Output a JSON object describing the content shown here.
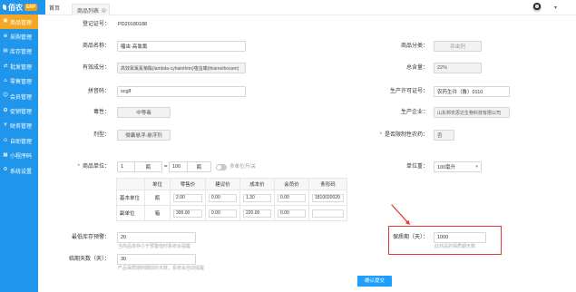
{
  "colors": {
    "sidebar": "#1f95ec",
    "sidebar_active": "#f5a623",
    "brand_badge": "#f39c12",
    "primary_button": "#1e9fff",
    "annotation": "#e53935"
  },
  "app": {
    "brand": "佰农",
    "badge": "ERP"
  },
  "sidebar": {
    "items": [
      {
        "label": "商品管理",
        "icon": "box-icon",
        "active": true
      },
      {
        "label": "采购管理",
        "icon": "cart-icon"
      },
      {
        "label": "库存管理",
        "icon": "inventory-icon"
      },
      {
        "label": "批发管理",
        "icon": "truck-icon"
      },
      {
        "label": "零售管理",
        "icon": "shop-icon"
      },
      {
        "label": "会员管理",
        "icon": "user-icon"
      },
      {
        "label": "促销管理",
        "icon": "gift-icon"
      },
      {
        "label": "财务管理",
        "icon": "yen-icon"
      },
      {
        "label": "自助管理",
        "icon": "self-service-icon"
      },
      {
        "label": "小程序码",
        "icon": "qrcode-icon"
      },
      {
        "label": "系统设置",
        "icon": "gear-icon"
      }
    ]
  },
  "header": {
    "tabs": [
      {
        "label": "首页"
      },
      {
        "label": "商品列表",
        "active": true,
        "closable": true,
        "close_icon": "close-icon"
      }
    ],
    "user_menu_icon": "chevron-down-icon"
  },
  "form": {
    "reg_no": {
      "label": "登记证号：",
      "value": "PD20180188"
    },
    "name": {
      "label": "商品名称：",
      "value": "噻虫·高氯氟"
    },
    "category": {
      "label": "商品分类：",
      "value": "杀虫剂"
    },
    "ingredient": {
      "label": "有效成分：",
      "value": "高效氯氟氰菊酯(lambda-cyhalothrin)噻虫嗪(thiamethoxam)"
    },
    "content": {
      "label": "总含量：",
      "value": "22%"
    },
    "pinyin": {
      "label": "拼音码：",
      "value": "scglf"
    },
    "license": {
      "label": "生产许可证号：",
      "value": "农药生许（鲁）0110"
    },
    "toxicity": {
      "label": "毒性：",
      "value": "中等毒"
    },
    "maker": {
      "label": "生产企业：",
      "value": "山东邦农思达生物科技有限公司"
    },
    "formulation": {
      "label": "剂型：",
      "value": "微囊悬浮-悬浮剂"
    },
    "restricted": {
      "required_mark": "*",
      "label": "是否限制性农药：",
      "value": "否"
    },
    "unit": {
      "required_mark": "*",
      "label": "商品单位：",
      "base_qty": "1",
      "base_unit": "瓶",
      "equals": "=",
      "sub_qty": "100",
      "sub_unit": "瓶",
      "multi_unit_on": false,
      "toggle_label": "多单位开/关"
    },
    "unit_weight": {
      "label": "单位重：",
      "value": "100毫升"
    },
    "price_table": {
      "headers": [
        "单位",
        "零售价",
        "建议价",
        "成本价",
        "会员价",
        "条形码"
      ],
      "rows": [
        {
          "name": "基本单位",
          "unit": "瓶",
          "retail": "2.00",
          "suggested": "0.00",
          "cost": "1.30",
          "member": "0.00",
          "barcode": "1810020020"
        },
        {
          "name": "副单位",
          "unit": "箱",
          "retail": "300.00",
          "suggested": "0.00",
          "cost": "220.00",
          "member": "0.00"
        }
      ]
    },
    "min_stock": {
      "label": "最低库存预警：",
      "value": "20",
      "hint": "当商品库存小于预警值时系统会提醒"
    },
    "shelf_life": {
      "label": "保质期（天）：",
      "value": "1000",
      "hint": "此商品的保质期天数"
    },
    "expiry_days": {
      "label": "临期天数（天）：",
      "value": "30",
      "hint": "产品保质期到期前的天数，系统会自动提醒"
    },
    "submit_label": "确认提交"
  }
}
